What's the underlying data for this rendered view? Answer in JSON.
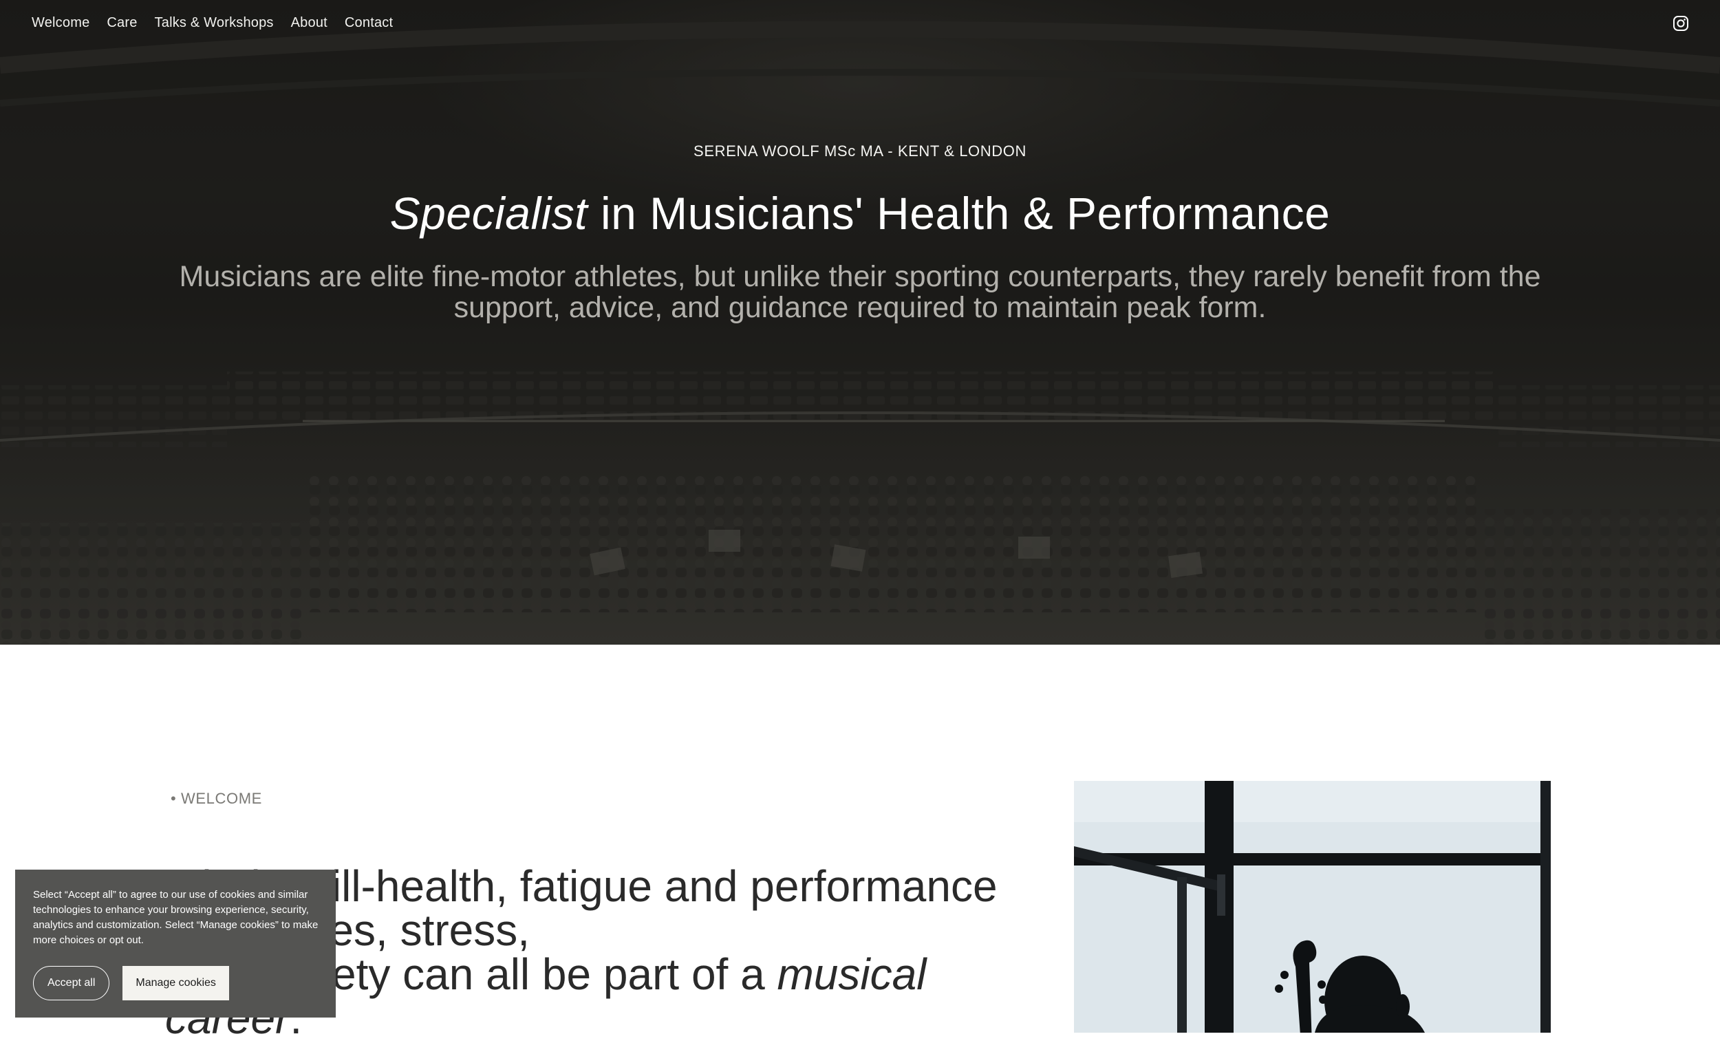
{
  "nav": {
    "items": [
      {
        "label": "Welcome"
      },
      {
        "label": "Care"
      },
      {
        "label": "Talks & Workshops"
      },
      {
        "label": "About"
      },
      {
        "label": "Contact"
      }
    ],
    "social_icon": "instagram-icon"
  },
  "hero": {
    "eyebrow": "SERENA WOOLF MSc MA - KENT & LONDON",
    "title_emphasis": "Specialist",
    "title_rest": " in Musicians' Health & Performance",
    "subtitle": "Musicians are elite fine-motor athletes, but unlike their sporting counterparts, they rarely benefit from the support, advice, and guidance required to maintain peak form."
  },
  "welcome": {
    "eyebrow": "• WELCOME",
    "statement_line1": "Injuries, ill-health, fatigue and performance challenges, stress,",
    "statement_line2_prefix": "and anxiety can all be part of a ",
    "statement_emphasis": "musical career",
    "statement_suffix": "."
  },
  "cookie_banner": {
    "text": "Select “Accept all” to agree to our use of cookies and similar technologies to enhance your browsing experience, security, analytics and customization. Select “Manage cookies” to make more choices or opt out.",
    "accept_label": "Accept all",
    "manage_label": "Manage cookies"
  },
  "colors": {
    "hero_background": "#1f1e1c",
    "cookie_background": "#545452",
    "body_text": "#2a2a2a",
    "eyebrow_text": "#7a7975"
  }
}
